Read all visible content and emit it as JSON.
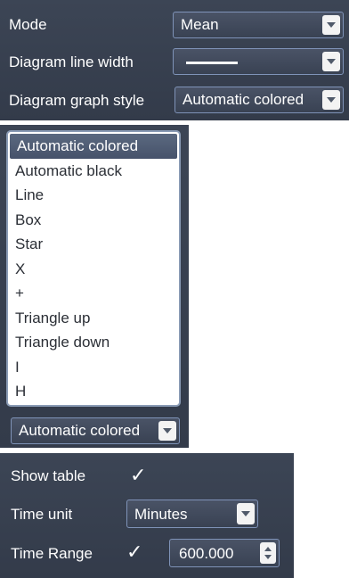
{
  "top": {
    "mode_label": "Mode",
    "mode_value": "Mean",
    "line_width_label": "Diagram line width",
    "graph_style_label": "Diagram graph style",
    "graph_style_value": "Automatic colored"
  },
  "dropdown": {
    "items": [
      "Automatic colored",
      "Automatic black",
      "Line",
      "Box",
      "Star",
      "X",
      "+",
      "Triangle up",
      "Triangle down",
      "I",
      "H"
    ],
    "selected": "Automatic colored",
    "combo_value": "Automatic colored"
  },
  "bottom": {
    "show_table_label": "Show table",
    "show_table_checked": true,
    "time_unit_label": "Time unit",
    "time_unit_value": "Minutes",
    "time_range_label": "Time Range",
    "time_range_checked": true,
    "time_range_value": "600.000"
  },
  "icons": {
    "checkmark": "✓"
  }
}
